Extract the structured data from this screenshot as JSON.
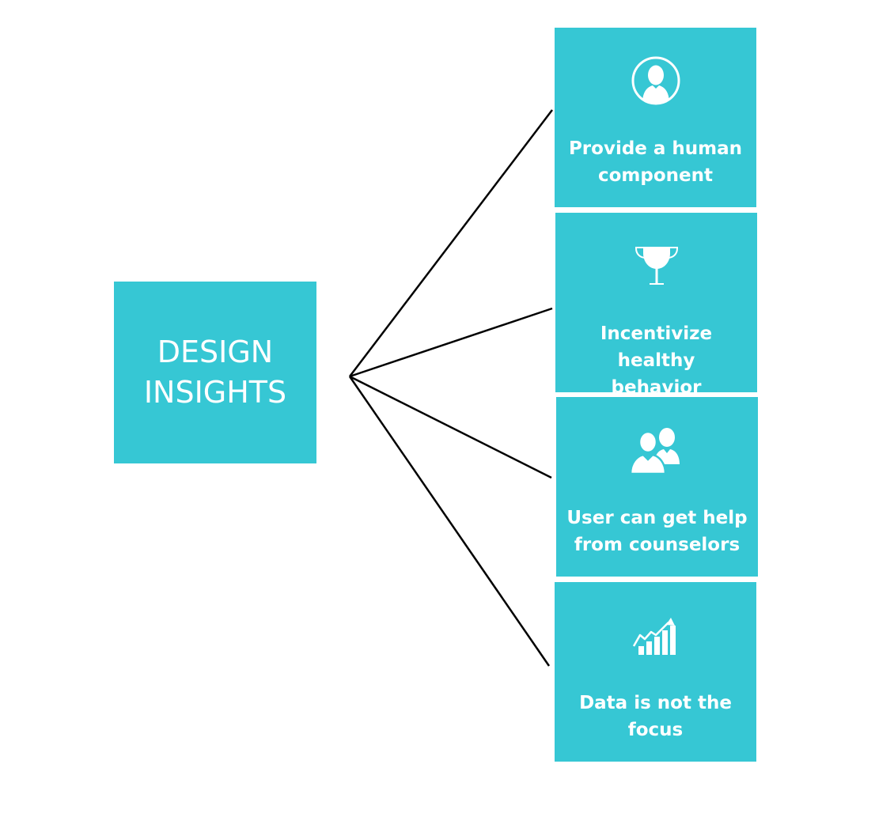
{
  "main": {
    "title_line1": "DESIGN",
    "title_line2": "INSIGHTS"
  },
  "insights": [
    {
      "icon": "person-icon",
      "line1": "Provide a human",
      "line2": "component"
    },
    {
      "icon": "trophy-icon",
      "line1": "Incentivize healthy",
      "line2": "behavior"
    },
    {
      "icon": "users-icon",
      "line1": "User can get help",
      "line2": "from counselors"
    },
    {
      "icon": "growth-chart-icon",
      "line1": "Data is not the",
      "line2": "focus"
    }
  ],
  "colors": {
    "box": "#36c7d4",
    "text": "#ffffff",
    "line": "#000000"
  }
}
